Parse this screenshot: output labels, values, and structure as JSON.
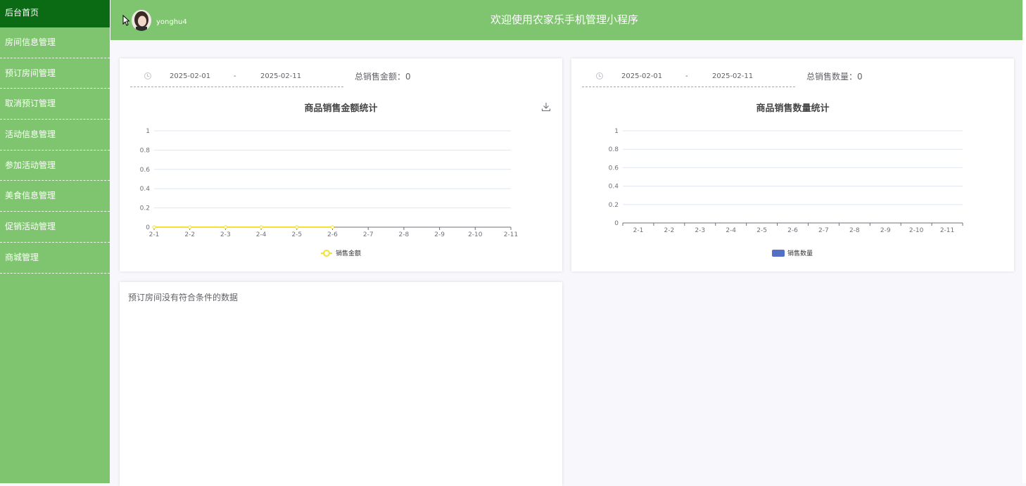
{
  "sidebar": {
    "items": [
      {
        "label": "后台首页",
        "active": true
      },
      {
        "label": "房间信息管理"
      },
      {
        "label": "预订房间管理"
      },
      {
        "label": "取消预订管理"
      },
      {
        "label": "活动信息管理"
      },
      {
        "label": "参加活动管理"
      },
      {
        "label": "美食信息管理"
      },
      {
        "label": "促销活动管理"
      },
      {
        "label": "商城管理"
      }
    ]
  },
  "header": {
    "username": "yonghu4",
    "title": "欢迎使用农家乐手机管理小程序"
  },
  "amount_card": {
    "date_start": "2025-02-01",
    "date_sep": "-",
    "date_end": "2025-02-11",
    "total_label": "总销售金额：0",
    "chart_title": "商品销售金额统计"
  },
  "qty_card": {
    "date_start": "2025-02-01",
    "date_sep": "-",
    "date_end": "2025-02-11",
    "total_label": "总销售数量：0",
    "chart_title": "商品销售数量统计"
  },
  "rooms_card": {
    "empty_message": "预订房间没有符合条件的数据"
  },
  "colors": {
    "sidebar_bg": "#7fc46f",
    "sidebar_active": "#0b6b14",
    "line_series": "#f5e132",
    "bar_series": "#5470c6"
  },
  "chart_data": [
    {
      "type": "line",
      "title": "商品销售金额统计",
      "categories": [
        "2-1",
        "2-2",
        "2-3",
        "2-4",
        "2-5",
        "2-6",
        "2-7",
        "2-8",
        "2-9",
        "2-10",
        "2-11"
      ],
      "series": [
        {
          "name": "销售金额",
          "values": [
            0,
            0,
            0,
            0,
            0,
            0
          ]
        }
      ],
      "yticks": [
        "0",
        "0.2",
        "0.4",
        "0.6",
        "0.8",
        "1"
      ],
      "ylim": [
        0,
        1
      ],
      "legend": "bottom-center"
    },
    {
      "type": "bar",
      "title": "商品销售数量统计",
      "categories": [
        "2-1",
        "2-2",
        "2-3",
        "2-4",
        "2-5",
        "2-6",
        "2-7",
        "2-8",
        "2-9",
        "2-10",
        "2-11"
      ],
      "series": [
        {
          "name": "销售数量",
          "values": []
        }
      ],
      "yticks": [
        "0",
        "0.2",
        "0.4",
        "0.6",
        "0.8",
        "1"
      ],
      "ylim": [
        0,
        1
      ],
      "legend": "bottom-center"
    }
  ]
}
